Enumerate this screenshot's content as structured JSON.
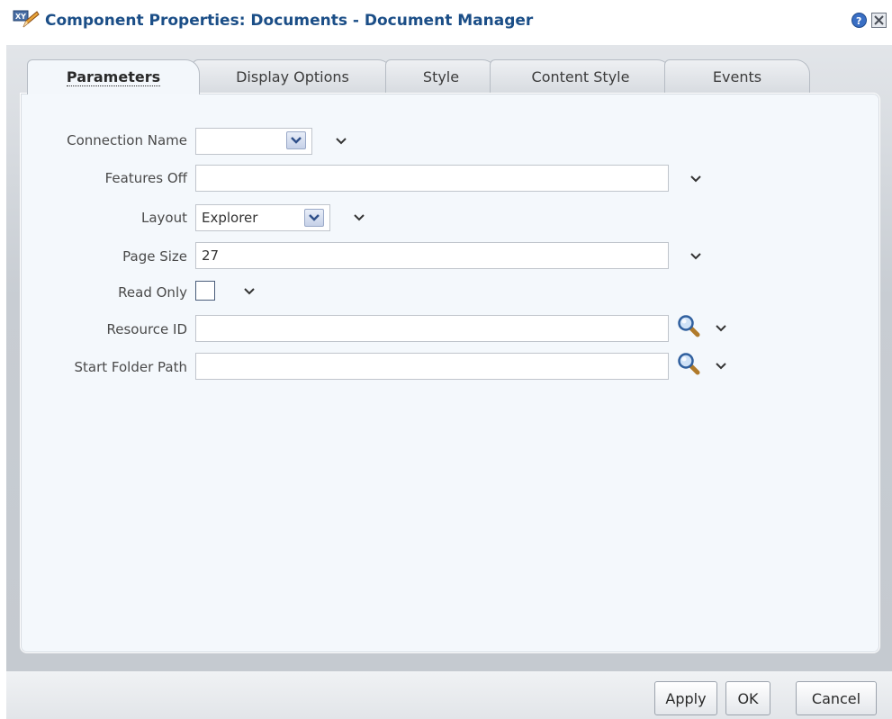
{
  "dialog": {
    "title": "Component Properties: Documents - Document Manager",
    "title_icon": "xy-pencil-icon",
    "help_icon": "help-icon",
    "close_icon": "close-icon"
  },
  "tabs": [
    {
      "label": "Parameters",
      "active": true
    },
    {
      "label": "Display Options",
      "active": false
    },
    {
      "label": "Style",
      "active": false
    },
    {
      "label": "Content Style",
      "active": false
    },
    {
      "label": "Events",
      "active": false
    }
  ],
  "form": {
    "connection_name": {
      "label": "Connection Name",
      "value": ""
    },
    "features_off": {
      "label": "Features Off",
      "value": ""
    },
    "layout": {
      "label": "Layout",
      "value": "Explorer"
    },
    "page_size": {
      "label": "Page Size",
      "value": "27"
    },
    "read_only": {
      "label": "Read Only",
      "checked": false
    },
    "resource_id": {
      "label": "Resource ID",
      "value": ""
    },
    "start_folder_path": {
      "label": "Start Folder Path",
      "value": ""
    }
  },
  "footer": {
    "apply_label": "Apply",
    "ok_label": "OK",
    "cancel_label": "Cancel"
  },
  "colors": {
    "title": "#1b4e87",
    "panel": "#f4f8fc",
    "body": "#c9ced4"
  }
}
